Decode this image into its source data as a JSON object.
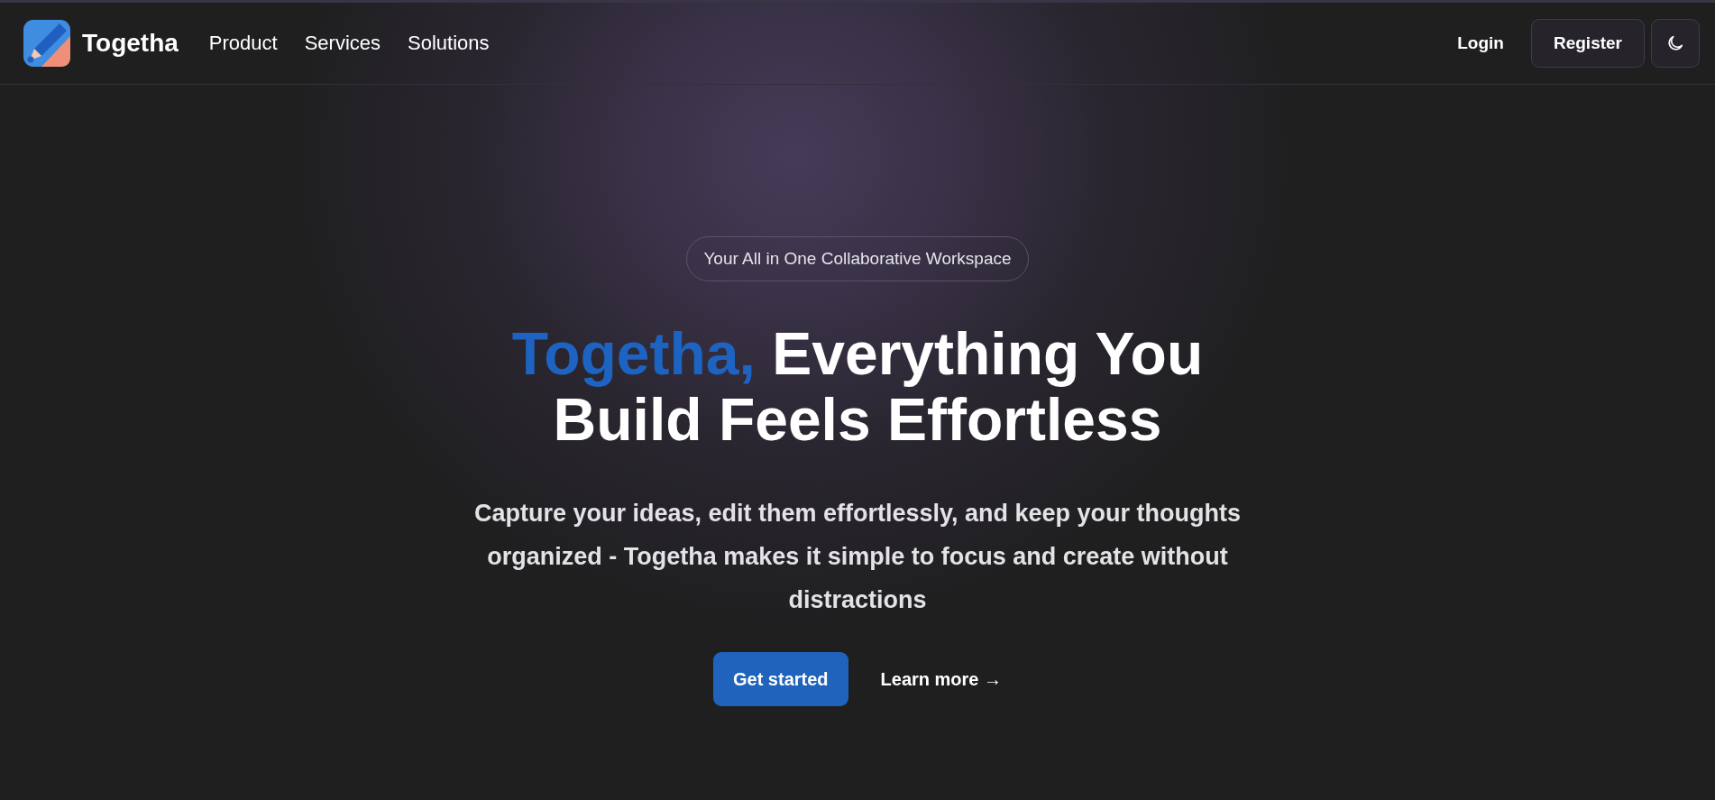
{
  "navbar": {
    "brand": "Togetha",
    "links": [
      {
        "label": "Product"
      },
      {
        "label": "Services"
      },
      {
        "label": "Solutions"
      }
    ],
    "login": "Login",
    "register": "Register"
  },
  "hero": {
    "badge": "Your All in One Collaborative Workspace",
    "headline": {
      "highlight": "Togetha,",
      "rest": "Everything You Build Feels Effortless"
    },
    "description": "Capture your ideas, edit them effortlessly, and keep your thoughts organized - Togetha makes it simple to focus and create without distractions",
    "primary_button": "Get started",
    "secondary_link": "Learn more →"
  }
}
